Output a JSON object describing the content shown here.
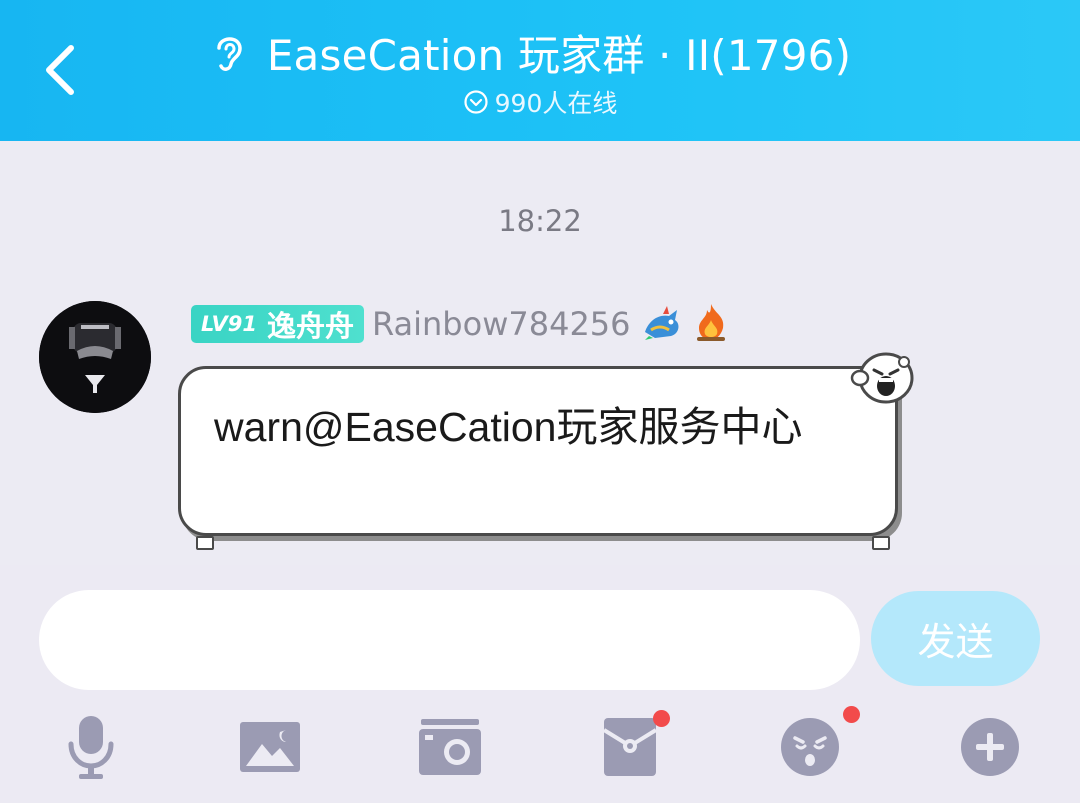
{
  "header": {
    "title": "EaseCation 玩家群 · II(1796)",
    "online": "990人在线"
  },
  "chat": {
    "timestamp": "18:22",
    "messages": [
      {
        "level": "LV91",
        "nickname": "逸舟舟",
        "username": "Rainbow784256",
        "text": "warn@EaseCation玩家服务中心"
      }
    ]
  },
  "input": {
    "value": "",
    "send_label": "发送"
  },
  "toolbar": {
    "icons": [
      "microphone-icon",
      "image-icon",
      "camera-icon",
      "red-packet-icon",
      "emoji-icon",
      "plus-icon"
    ]
  },
  "colors": {
    "header": "#1ec3f7",
    "background": "#ecebf3",
    "badge": "#43d9c9",
    "send_button": "#b4e8fb",
    "notification_dot": "#f24b4b",
    "toolbar_icon": "#9b9bb3"
  }
}
